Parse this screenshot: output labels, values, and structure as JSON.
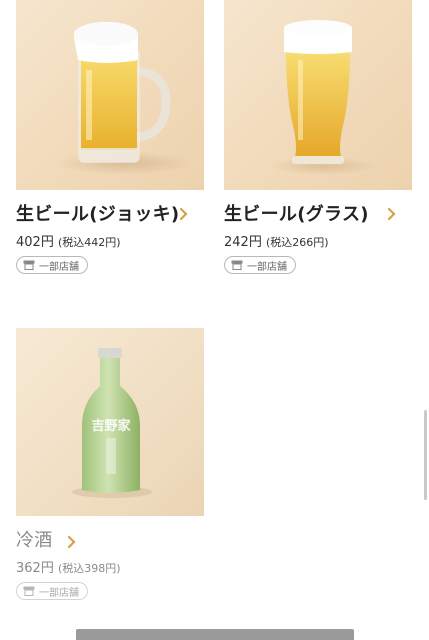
{
  "items": [
    {
      "name": "生ビール(ジョッキ)",
      "price": "402円",
      "tax_price": "(税込442円)",
      "badge": "一部店舗",
      "image_icon": "beer-mug-icon"
    },
    {
      "name": "生ビール(グラス)",
      "price": "242円",
      "tax_price": "(税込266円)",
      "badge": "一部店舗",
      "image_icon": "beer-glass-icon"
    },
    {
      "name": "冷酒",
      "price": "362円",
      "tax_price": "(税込398円)",
      "badge": "一部店舗",
      "image_icon": "sake-bottle-icon",
      "bottle_label": "吉野家"
    }
  ],
  "colors": {
    "accent_chevron": "#d9a04a",
    "text_main": "#222222",
    "text_muted": "#8a8a8a"
  }
}
